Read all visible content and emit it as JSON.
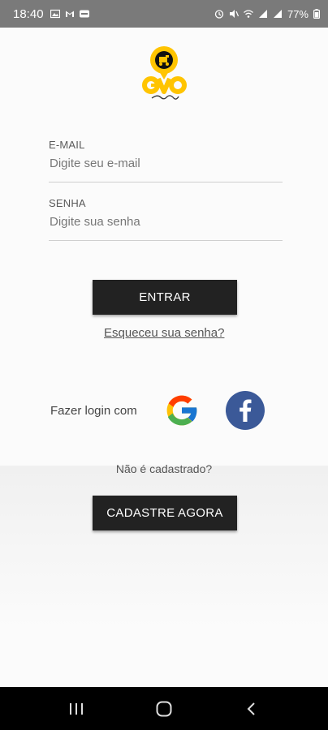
{
  "status_bar": {
    "time": "18:40",
    "battery": "77%",
    "left_icons": [
      "image-icon",
      "gmail-icon",
      "app-icon"
    ],
    "right_icons": [
      "alarm-icon",
      "mute-icon",
      "wifi-icon",
      "signal-icon",
      "signal-icon",
      "battery-icon"
    ]
  },
  "logo": {
    "icon": "gvo-delivery-logo",
    "brand_color": "#FFC400"
  },
  "login_form": {
    "email": {
      "label": "E-MAIL",
      "placeholder": "Digite seu e-mail",
      "value": ""
    },
    "password": {
      "label": "SENHA",
      "placeholder": "Digite sua senha",
      "value": ""
    },
    "submit_label": "ENTRAR",
    "forgot_label": "Esqueceu sua senha?"
  },
  "social_login": {
    "label": "Fazer login com",
    "providers": [
      {
        "name": "Google",
        "icon": "google-icon"
      },
      {
        "name": "Facebook",
        "icon": "facebook-icon",
        "color": "#3B5998"
      }
    ]
  },
  "register": {
    "question": "Não é cadastrado?",
    "button_label": "CADASTRE AGORA"
  },
  "nav_bar": {
    "icons": [
      "recents-icon",
      "home-icon",
      "back-icon"
    ]
  },
  "colors": {
    "button_bg": "#222222",
    "status_bar_bg": "#7A7A7A",
    "nav_bar_bg": "#000000"
  }
}
